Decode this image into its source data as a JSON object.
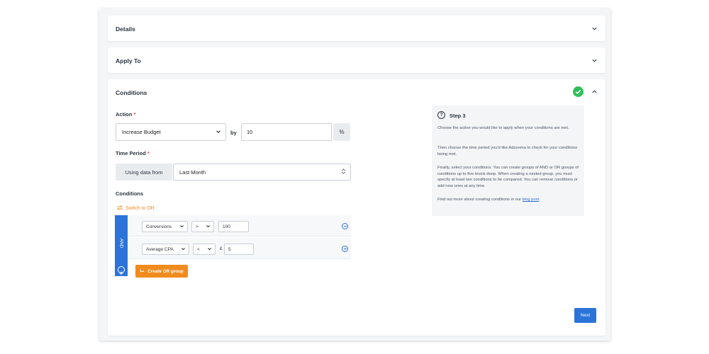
{
  "accent_color": "#2b73d8",
  "orange_color": "#f08b1d",
  "success_color": "#2fbf5b",
  "sections": {
    "details": {
      "title": "Details"
    },
    "apply_to": {
      "title": "Apply To"
    },
    "conditions": {
      "title": "Conditions",
      "status": "complete"
    }
  },
  "action": {
    "label": "Action",
    "required_mark": "*",
    "selected": "Increase Budget",
    "by_label": "by",
    "amount": "10",
    "unit": "%"
  },
  "time_period": {
    "label": "Time Period",
    "required_mark": "*",
    "prefix": "Using data from",
    "selected": "Last Month"
  },
  "conditions_builder": {
    "label": "Conditions",
    "switch_label": "Switch to OR",
    "group_operator": "AND",
    "rows": [
      {
        "metric": "Conversions",
        "operator": ">",
        "currency": "",
        "value": "100"
      },
      {
        "metric": "Average CPA",
        "operator": "<",
        "currency": "£",
        "value": "5"
      }
    ],
    "create_group_label": "Create OR group"
  },
  "help": {
    "title": "Step 3",
    "paragraphs": [
      "Choose the action you would like to apply when your conditions are met.",
      "Then choose the time period you'd like Adzooma to check for your conditions being met.",
      "Finally, select your conditions. You can create groups of AND or OR groups of conditions up to five levels deep. When creating a nested group, you must specify at least two conditions to be compared. You can remove conditions or add new ones at any time."
    ],
    "footer_text": "Find out more about creating conditions in our",
    "link_text": "blog post",
    "footer_end": "."
  },
  "next_label": "Next"
}
